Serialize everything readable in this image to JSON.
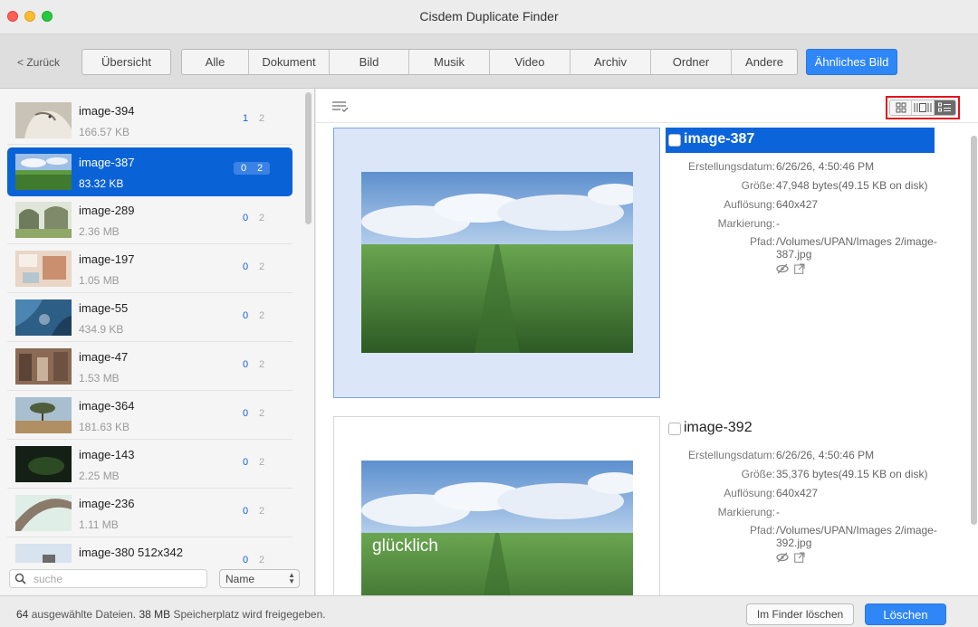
{
  "window": {
    "title": "Cisdem Duplicate Finder"
  },
  "toolbar": {
    "back_label": "< Zurück",
    "overview_label": "Übersicht",
    "segments": [
      "Alle",
      "Dokument",
      "Bild",
      "Musik",
      "Video",
      "Archiv",
      "Ordner",
      "Andere"
    ],
    "similar_label": "Ähnliches Bild"
  },
  "sidebar": {
    "items": [
      {
        "name": "image-394",
        "size": "166.57 KB",
        "count_a": "1",
        "count_b": "2",
        "thumb": "horse"
      },
      {
        "name": "image-387",
        "size": "83.32 KB",
        "count_a": "0",
        "count_b": "2",
        "thumb": "field",
        "selected": true
      },
      {
        "name": "image-289",
        "size": "2.36 MB",
        "count_a": "0",
        "count_b": "2",
        "thumb": "arch"
      },
      {
        "name": "image-197",
        "size": "1.05 MB",
        "count_a": "0",
        "count_b": "2",
        "thumb": "room"
      },
      {
        "name": "image-55",
        "size": "434.9 KB",
        "count_a": "0",
        "count_b": "2",
        "thumb": "aerial"
      },
      {
        "name": "image-47",
        "size": "1.53 MB",
        "count_a": "0",
        "count_b": "2",
        "thumb": "street"
      },
      {
        "name": "image-364",
        "size": "181.63 KB",
        "count_a": "0",
        "count_b": "2",
        "thumb": "tree"
      },
      {
        "name": "image-143",
        "size": "2.25 MB",
        "count_a": "0",
        "count_b": "2",
        "thumb": "dark"
      },
      {
        "name": "image-236",
        "size": "1.11 MB",
        "count_a": "0",
        "count_b": "2",
        "thumb": "bridge"
      },
      {
        "name": "image-380 512x342",
        "size": "",
        "count_a": "0",
        "count_b": "2",
        "thumb": "sky"
      }
    ],
    "search_placeholder": "suche",
    "sort_value": "Name"
  },
  "main": {
    "cards": [
      {
        "title": "image-387",
        "selected": true,
        "created_label": "Erstellungsdatum:",
        "created": "6/26/26, 4:50:46 PM",
        "size_label": "Größe:",
        "size": "47,948 bytes(49.15 KB on disk)",
        "resolution_label": "Auflösung:",
        "resolution": "640x427",
        "tag_label": "Markierung:",
        "tag": "-",
        "path_label": "Pfad:",
        "path": "/Volumes/UPAN/Images 2/image-387.jpg",
        "overlay": ""
      },
      {
        "title": "image-392",
        "selected": false,
        "created_label": "Erstellungsdatum:",
        "created": "6/26/26, 4:50:46 PM",
        "size_label": "Größe:",
        "size": "35,376 bytes(49.15 KB on disk)",
        "resolution_label": "Auflösung:",
        "resolution": "640x427",
        "tag_label": "Markierung:",
        "tag": "-",
        "path_label": "Pfad:",
        "path": "/Volumes/UPAN/Images 2/image-392.jpg",
        "overlay": "glücklich"
      }
    ]
  },
  "status": {
    "count": "64",
    "text_a": "ausgewählte Dateien.",
    "size": "38 MB",
    "text_b": "Speicherplatz wird freigegeben.",
    "finder_delete_label": "Im Finder löschen",
    "delete_label": "Löschen"
  },
  "colors": {
    "accent": "#2f86f6",
    "selection": "#0a63d6",
    "highlight_box": "#e0141c"
  }
}
